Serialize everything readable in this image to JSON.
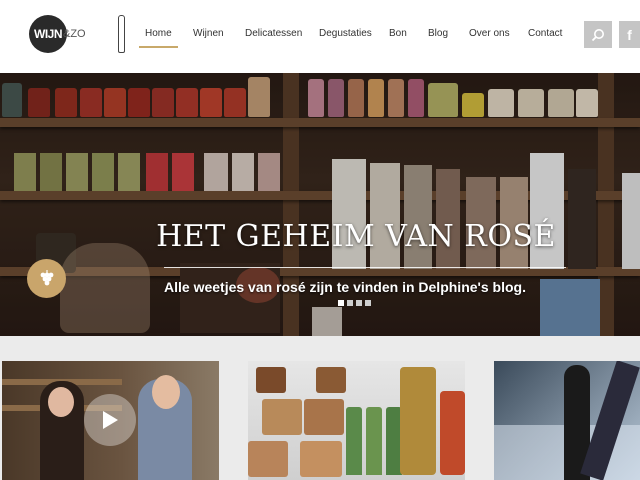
{
  "logo": {
    "text": "WIJN",
    "suffix": "&ZO"
  },
  "nav": {
    "items": [
      {
        "label": "Home",
        "active": true
      },
      {
        "label": "Wijnen",
        "active": false
      },
      {
        "label": "Delicatessen",
        "active": false
      },
      {
        "label": "Degustaties",
        "active": false
      },
      {
        "label": "Bon",
        "active": false
      },
      {
        "label": "Blog",
        "active": false
      },
      {
        "label": "Over ons",
        "active": false
      },
      {
        "label": "Contact",
        "active": false
      }
    ]
  },
  "header_buttons": {
    "search_icon": "search-icon",
    "facebook_glyph": "f"
  },
  "hero": {
    "title": "HET GEHEIM VAN ROSÉ",
    "subtitle": "Alle weetjes van rosé zijn te vinden in Delphine's blog.",
    "slides": {
      "count": 4,
      "active": 0
    }
  },
  "cards": [
    {
      "name": "video-card",
      "has_play": true
    },
    {
      "name": "delicatessen-card",
      "has_play": false
    },
    {
      "name": "wine-card",
      "has_play": false
    }
  ],
  "colors": {
    "accent": "#c8a96a",
    "header_bg": "#ffffff",
    "page_bg": "#ebebeb",
    "button_grey": "#c5c5c5"
  }
}
